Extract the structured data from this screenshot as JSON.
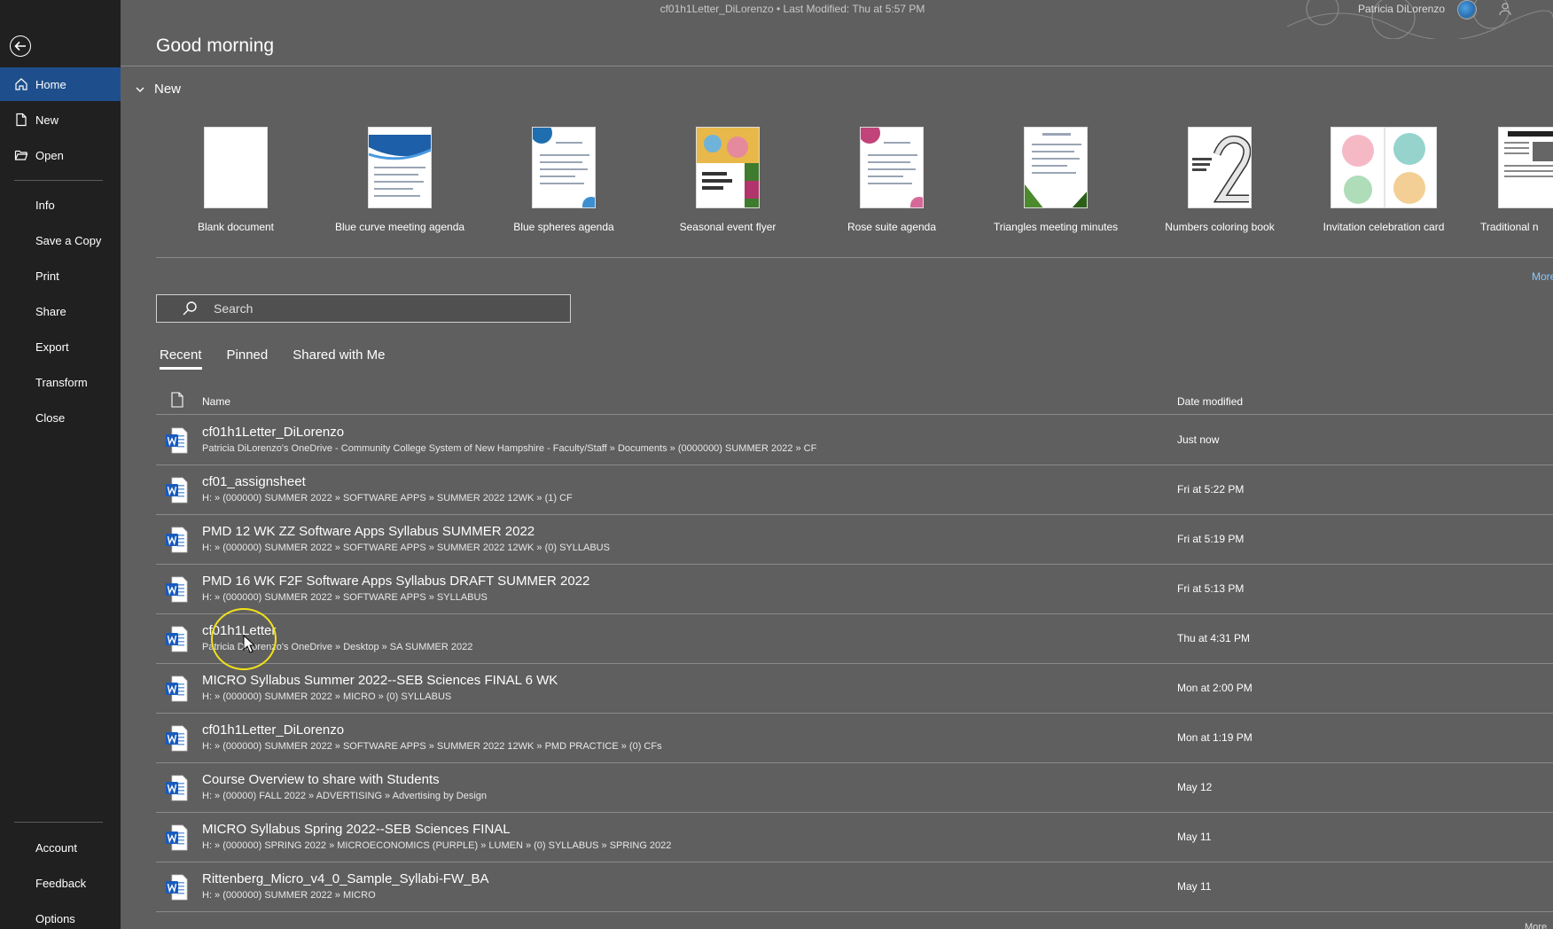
{
  "titlebar": {
    "doc_title": "cf01h1Letter_DiLorenzo • Last Modified: Thu at 5:57 PM",
    "user_name": "Patricia DiLorenzo"
  },
  "sidebar": {
    "back_icon": "back-arrow-icon",
    "items_top": [
      {
        "label": "Home",
        "icon": "home-icon",
        "active": true
      },
      {
        "label": "New",
        "icon": "new-document-icon",
        "active": false
      },
      {
        "label": "Open",
        "icon": "open-folder-icon",
        "active": false
      }
    ],
    "items_middle": [
      "Info",
      "Save a Copy",
      "Print",
      "Share",
      "Export",
      "Transform",
      "Close"
    ],
    "items_bottom": [
      "Account",
      "Feedback",
      "Options"
    ],
    "active_color": "#1e4f8c"
  },
  "main": {
    "greeting": "Good morning",
    "new_section_label": "New",
    "templates": [
      {
        "label": "Blank document"
      },
      {
        "label": "Blue curve meeting agenda"
      },
      {
        "label": "Blue spheres agenda"
      },
      {
        "label": "Seasonal event flyer"
      },
      {
        "label": "Rose suite agenda"
      },
      {
        "label": "Triangles meeting minutes"
      },
      {
        "label": "Numbers coloring book"
      },
      {
        "label": "Invitation celebration card"
      },
      {
        "label": "Traditional n"
      }
    ],
    "more_templates_label": "More",
    "search": {
      "placeholder": "Search"
    },
    "tabs": [
      {
        "label": "Recent",
        "active": true
      },
      {
        "label": "Pinned",
        "active": false
      },
      {
        "label": "Shared with Me",
        "active": false
      }
    ],
    "list_headers": {
      "name": "Name",
      "date": "Date modified"
    },
    "files": [
      {
        "name": "cf01h1Letter_DiLorenzo",
        "path": "Patricia DiLorenzo's OneDrive - Community College System of New Hampshire - Faculty/Staff » Documents » (0000000) SUMMER 2022 » CF",
        "date": "Just now"
      },
      {
        "name": "cf01_assignsheet",
        "path": "H: » (000000) SUMMER 2022 » SOFTWARE APPS » SUMMER 2022 12WK » (1) CF",
        "date": "Fri at 5:22 PM"
      },
      {
        "name": "PMD 12 WK ZZ Software Apps Syllabus SUMMER 2022",
        "path": "H: » (000000) SUMMER 2022 » SOFTWARE APPS » SUMMER 2022 12WK » (0) SYLLABUS",
        "date": "Fri at 5:19 PM"
      },
      {
        "name": "PMD 16 WK F2F Software Apps Syllabus  DRAFT SUMMER 2022",
        "path": "H: » (000000) SUMMER 2022 » SOFTWARE APPS » SYLLABUS",
        "date": "Fri at 5:13 PM"
      },
      {
        "name": "cf01h1Letter",
        "path": "Patricia DiLorenzo's OneDrive » Desktop » SA SUMMER 2022",
        "date": "Thu at 4:31 PM"
      },
      {
        "name": "MICRO Syllabus Summer 2022--SEB Sciences FINAL 6 WK",
        "path": "H: » (000000) SUMMER 2022 » MICRO » (0) SYLLABUS",
        "date": "Mon at 2:00 PM"
      },
      {
        "name": "cf01h1Letter_DiLorenzo",
        "path": "H: » (000000) SUMMER 2022 » SOFTWARE APPS » SUMMER 2022 12WK » PMD PRACTICE » (0) CFs",
        "date": "Mon at 1:19 PM"
      },
      {
        "name": "Course Overview to share with Students",
        "path": "H: » (00000) FALL 2022 » ADVERTISING » Advertising by Design",
        "date": "May 12"
      },
      {
        "name": "MICRO Syllabus Spring 2022--SEB Sciences FINAL",
        "path": "H: » (000000) SPRING 2022 » MICROECONOMICS (PURPLE) » LUMEN » (0) SYLLABUS » SPRING 2022",
        "date": "May 11"
      },
      {
        "name": "Rittenberg_Micro_v4_0_Sample_Syllabi-FW_BA",
        "path": "H: » (000000) SUMMER 2022 » MICRO",
        "date": "May 11"
      }
    ],
    "more_bottom_label": "More"
  },
  "colors": {
    "background": "#5f5f5f",
    "sidebar": "#202020",
    "word_blue": "#185abd",
    "link": "#8cc8ff",
    "cursor_highlight": "#f2e11a"
  }
}
